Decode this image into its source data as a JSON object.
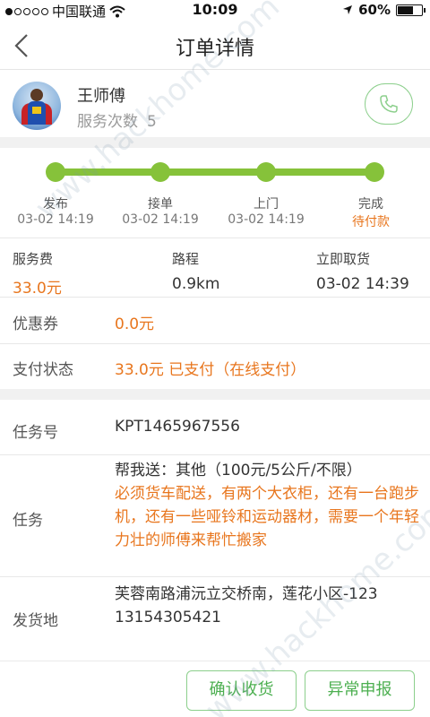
{
  "status_bar": {
    "carrier": "中国联通",
    "time": "10:09",
    "battery": "60%",
    "battery_level": 0.6
  },
  "nav": {
    "back_icon": "chevron-left-icon",
    "title": "订单详情"
  },
  "courier": {
    "name": "王师傅",
    "service_count_label": "服务次数",
    "service_count": "5",
    "phone_icon": "phone-icon"
  },
  "progress": {
    "steps": [
      {
        "label": "发布",
        "time": "03-02 14:19"
      },
      {
        "label": "接单",
        "time": "03-02 14:19"
      },
      {
        "label": "上门",
        "time": "03-02 14:19"
      },
      {
        "label": "完成",
        "time": "待付款"
      }
    ],
    "color": "#86c23a"
  },
  "info": {
    "fee_label": "服务费",
    "fee_value": "33.0元",
    "distance_label": "路程",
    "distance_value": "0.9km",
    "pickup_label": "立即取货",
    "pickup_value": "03-02 14:39"
  },
  "coupon": {
    "label": "优惠券",
    "value": "0.0元"
  },
  "payment": {
    "label": "支付状态",
    "value": "33.0元 已支付（在线支付）"
  },
  "task_no": {
    "label": "任务号",
    "value": "KPT1465967556"
  },
  "task": {
    "label": "任务",
    "line1": "帮我送：其他（100元/5公斤/不限）",
    "desc": "必须货车配送，有两个大衣柜，还有一台跑步机，还有一些哑铃和运动器材，需要一个年轻力壮的师傅来帮忙搬家"
  },
  "origin": {
    "label": "发货地",
    "address": "芙蓉南路浦沅立交桥南，莲花小区-123",
    "phone": "13154305421"
  },
  "buttons": {
    "confirm": "确认收货",
    "report": "异常申报"
  },
  "watermark": "www.hackhome.com",
  "colors": {
    "accent_green": "#86c23a",
    "orange": "#e8761e",
    "button_green": "#4caf50"
  }
}
